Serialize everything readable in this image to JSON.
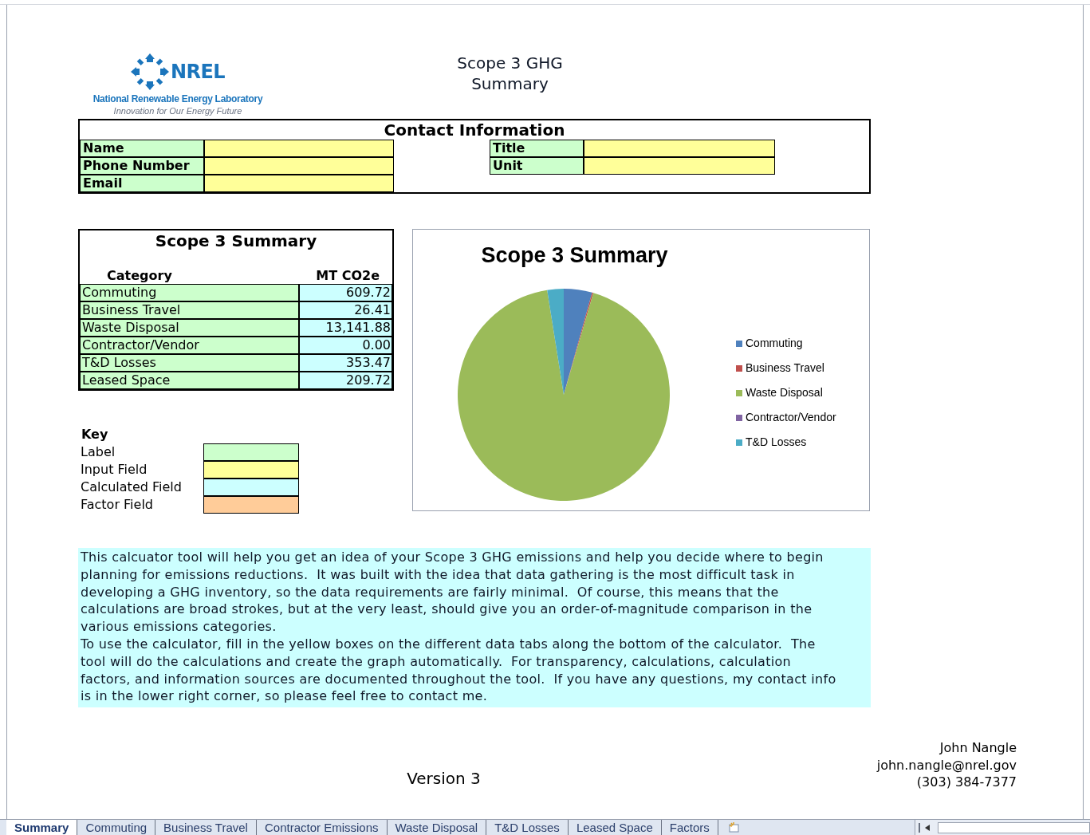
{
  "logo": {
    "wordmark": "NREL",
    "name": "National Renewable Energy Laboratory",
    "tagline": "Innovation for Our Energy Future"
  },
  "title": [
    "Scope 3 GHG",
    "Summary"
  ],
  "contact": {
    "heading": "Contact Information",
    "left_fields": [
      {
        "label": "Name"
      },
      {
        "label": "Phone Number"
      },
      {
        "label": "Email"
      }
    ],
    "right_fields": [
      {
        "label": "Title"
      },
      {
        "label": "Unit"
      }
    ]
  },
  "summary_table": {
    "title": "Scope 3 Summary",
    "columns": [
      "Category",
      "MT CO2e"
    ],
    "rows": [
      [
        "Commuting",
        "609.72"
      ],
      [
        "Business Travel",
        "26.41"
      ],
      [
        "Waste Disposal",
        "13,141.88"
      ],
      [
        "Contractor/Vendor",
        "0.00"
      ],
      [
        "T&D Losses",
        "353.47"
      ],
      [
        "Leased Space",
        "209.72"
      ]
    ]
  },
  "key": {
    "heading": "Key",
    "items": [
      {
        "label": "Label",
        "color": "#ccffcc"
      },
      {
        "label": "Input Field",
        "color": "#ffff99"
      },
      {
        "label": "Calculated Field",
        "color": "#ccffff"
      },
      {
        "label": "Factor Field",
        "color": "#ffcc99"
      }
    ]
  },
  "chart": {
    "chart_data": {
      "type": "pie",
      "title": "Scope 3 Summary",
      "categories": [
        "Commuting",
        "Business Travel",
        "Waste Disposal",
        "Contractor/Vendor",
        "T&D Losses"
      ],
      "series": [
        {
          "values": [
            4.3146,
            0.1869,
            92.9972,
            0,
            2.5013
          ]
        }
      ],
      "legend": true
    },
    "slices": [
      {
        "color": "#4f81bd"
      },
      {
        "color": "#c0504d"
      },
      {
        "color": "#9bbb59"
      },
      {
        "color": "#8064a2"
      },
      {
        "color": "#4bacc6"
      }
    ]
  },
  "description": [
    "This calcuator tool will help you get an idea of your Scope 3 GHG emissions and help you decide where to begin planning for emissions reductions.  It was built with the idea that data gathering is the most difficult task in developing a GHG inventory, so the data requirements are fairly minimal.  Of course, this means that the calculations are broad strokes, but at the very least, should give you an order-of-magnitude comparison in the various emissions categories.",
    "To use the calculator, fill in the yellow boxes on the different data tabs along the bottom of the calculator.  The tool will do the calculations and create the graph automatically.  For transparency, calculations, calculation factors, and information sources are documented throughout the tool.  If you have any questions, my contact info is in the lower right corner, so please feel free to contact me."
  ],
  "version": "Version 3",
  "author": {
    "name": "John Nangle",
    "email": "john.nangle@nrel.gov",
    "phone": "(303) 384-7377"
  },
  "sheet_tabs": [
    {
      "label": "Summary",
      "selected": true
    },
    {
      "label": "Commuting",
      "selected": false
    },
    {
      "label": "Business Travel",
      "selected": false
    },
    {
      "label": "Contractor Emissions",
      "selected": false
    },
    {
      "label": "Waste Disposal",
      "selected": false
    },
    {
      "label": "T&D Losses",
      "selected": false
    },
    {
      "label": "Leased Space",
      "selected": false
    },
    {
      "label": "Factors",
      "selected": false
    }
  ]
}
